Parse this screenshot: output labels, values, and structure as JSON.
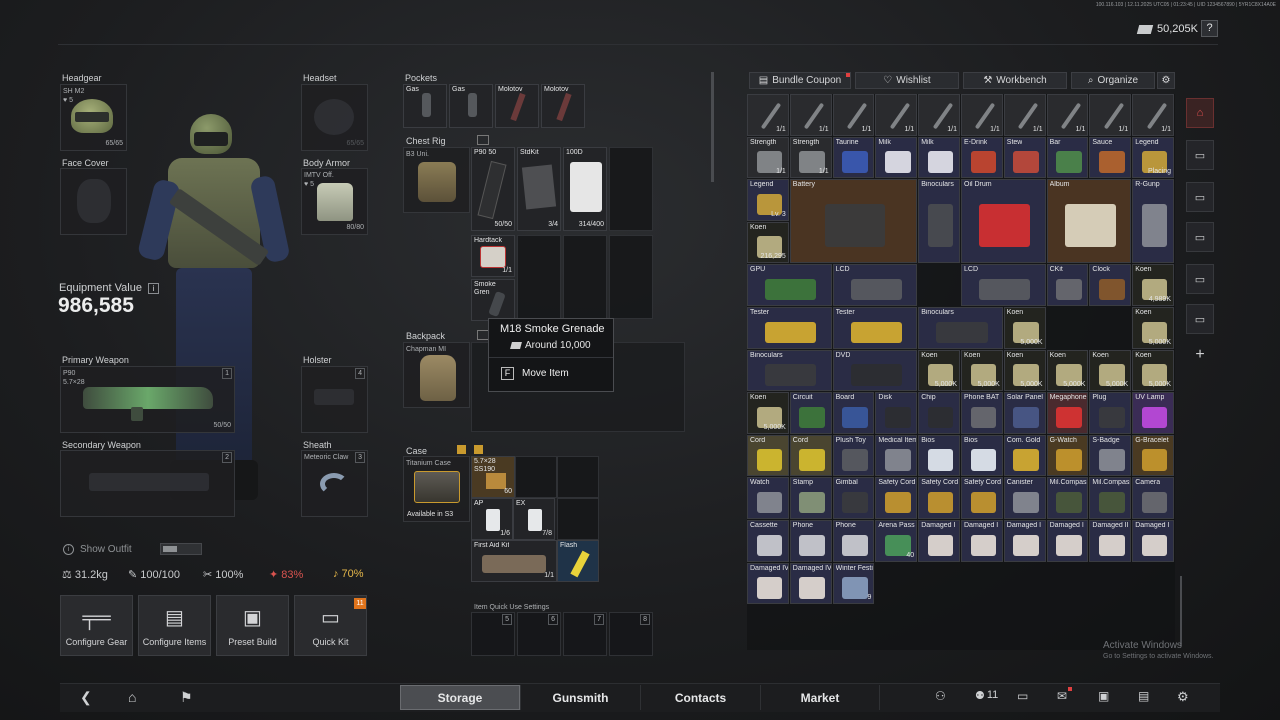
{
  "header": {
    "sys_text": "100.116.103 | 12.11.2025 UTC05 | 01:23:45 | UID 1234567890 | 5YR1C8X14A0E",
    "currency_value": "50,205K",
    "help_label": "?"
  },
  "loadout": {
    "headgear": {
      "label": "Headgear",
      "item": "SH M2",
      "level": "5",
      "durability": "65/65"
    },
    "headset": {
      "label": "Headset",
      "durability": "65/65"
    },
    "face_cover": {
      "label": "Face Cover"
    },
    "body_armor": {
      "label": "Body Armor",
      "item": "IMTV Off.",
      "level": "5",
      "durability": "80/80"
    },
    "equipment_value_label": "Equipment Value",
    "equipment_value_info": "i",
    "equipment_value": "986,585",
    "primary": {
      "label": "Primary Weapon",
      "item": "P90",
      "ammo": "5.7×28",
      "slot": "1",
      "mag": "50/50"
    },
    "holster": {
      "label": "Holster",
      "slot": "4"
    },
    "secondary": {
      "label": "Secondary Weapon",
      "slot": "2"
    },
    "sheath": {
      "label": "Sheath",
      "item": "Meteoric Claw",
      "slot": "3"
    },
    "show_outfit": "Show Outfit",
    "stats": {
      "weight": "31.2kg",
      "durability": "100/100",
      "energy": "100%",
      "hydration": "83%",
      "other": "70%"
    },
    "buttons": {
      "configure_gear": "Configure Gear",
      "configure_items": "Configure Items",
      "preset_build": "Preset Build",
      "quick_kit": "Quick Kit",
      "quick_kit_badge": "11"
    }
  },
  "pockets": {
    "label": "Pockets",
    "items": [
      "Gas",
      "Gas",
      "Molotov",
      "Molotov"
    ]
  },
  "chest_rig": {
    "label": "Chest Rig",
    "item": "B3 Uni.",
    "p90_label": "P90 50",
    "p90_count": "50/50",
    "stdkit_label": "StdKit",
    "stdkit_count": "3/4",
    "label_100d": "100D",
    "count_100d": "314/400",
    "hardtack_label": "Hardtack",
    "hardtack_count": "1/1",
    "smoke_label": "Smoke Gren"
  },
  "backpack": {
    "label": "Backpack",
    "item": "Chapman MI"
  },
  "tooltip": {
    "title": "M18 Smoke Grenade",
    "price": "Around 10,000",
    "key": "F",
    "action": "Move Item"
  },
  "case": {
    "label": "Case",
    "item": "Titanium Case",
    "availability": "Available in S3",
    "ammo_label": "5.7×28 SS190",
    "ammo_count": "60",
    "ap_label": "AP",
    "ap_count": "1/6",
    "ex_label": "EX",
    "ex_count": "7/8",
    "firstaid_label": "First Aid Kit",
    "firstaid_count": "1/1",
    "flash_label": "Flash"
  },
  "quick_use": {
    "label": "Item Quick Use Settings",
    "slots": [
      "5",
      "6",
      "7",
      "8"
    ]
  },
  "storage_toolbar": {
    "bundle_coupon": "Bundle Coupon",
    "wishlist": "Wishlist",
    "workbench": "Workbench",
    "organize": "Organize"
  },
  "storage": {
    "row1_count": "1/1",
    "strength": "Strength",
    "taurine": "Taurine",
    "milk": "Milk",
    "edrink": "E-Drink",
    "stew": "Stew",
    "bar": "Bar",
    "sauce": "Sauce",
    "legend": "Legend",
    "legend_lv": "Lv. 3",
    "placing": "Placing",
    "battery": "Battery",
    "binoculars": "Binoculars",
    "oil_drum": "Oil Drum",
    "album": "Album",
    "rgunp": "R-Gunp",
    "koen": "Koen",
    "koen_216": "216,295",
    "koen_4989": "4,989K",
    "koen_5000": "5,000K",
    "gpu": "GPU",
    "lcd": "LCD",
    "ckit": "CKit",
    "clock": "Clock",
    "tester": "Tester",
    "dvd": "DVD",
    "circuit": "Circuit",
    "board": "Board",
    "disk": "Disk",
    "chip": "Chip",
    "phone_bat": "Phone BAT",
    "solar_panel": "Solar Panel",
    "megaphone": "Megaphone",
    "plug": "Plug",
    "uv_lamp": "UV Lamp",
    "cord": "Cord",
    "plush_toy": "Plush Toy",
    "medical_item": "Medical Item",
    "bios": "Bios",
    "com_gold": "Com. Gold",
    "g_watch": "G-Watch",
    "s_badge": "S-Badge",
    "g_bracelet": "G-Bracelet",
    "watch": "Watch",
    "stamp": "Stamp",
    "gimbal": "Gimbal",
    "safety_cord": "Safety Cord",
    "canister": "Canister",
    "mil_compass": "Mil.Compass",
    "camera": "Camera",
    "cassette": "Cassette",
    "phone": "Phone",
    "arena_pass": "Arena Pass",
    "arena_count": "40",
    "damaged_i": "Damaged I",
    "damaged_ii": "Damaged II",
    "damaged_iv": "Damaged IV",
    "winter_festival": "Winter Festival",
    "winter_count": "9"
  },
  "watermark": {
    "line1": "Activate Windows",
    "line2": "Go to Settings to activate Windows."
  },
  "nav": {
    "storage": "Storage",
    "gunsmith": "Gunsmith",
    "contacts": "Contacts",
    "market": "Market",
    "friends_count": "11"
  }
}
